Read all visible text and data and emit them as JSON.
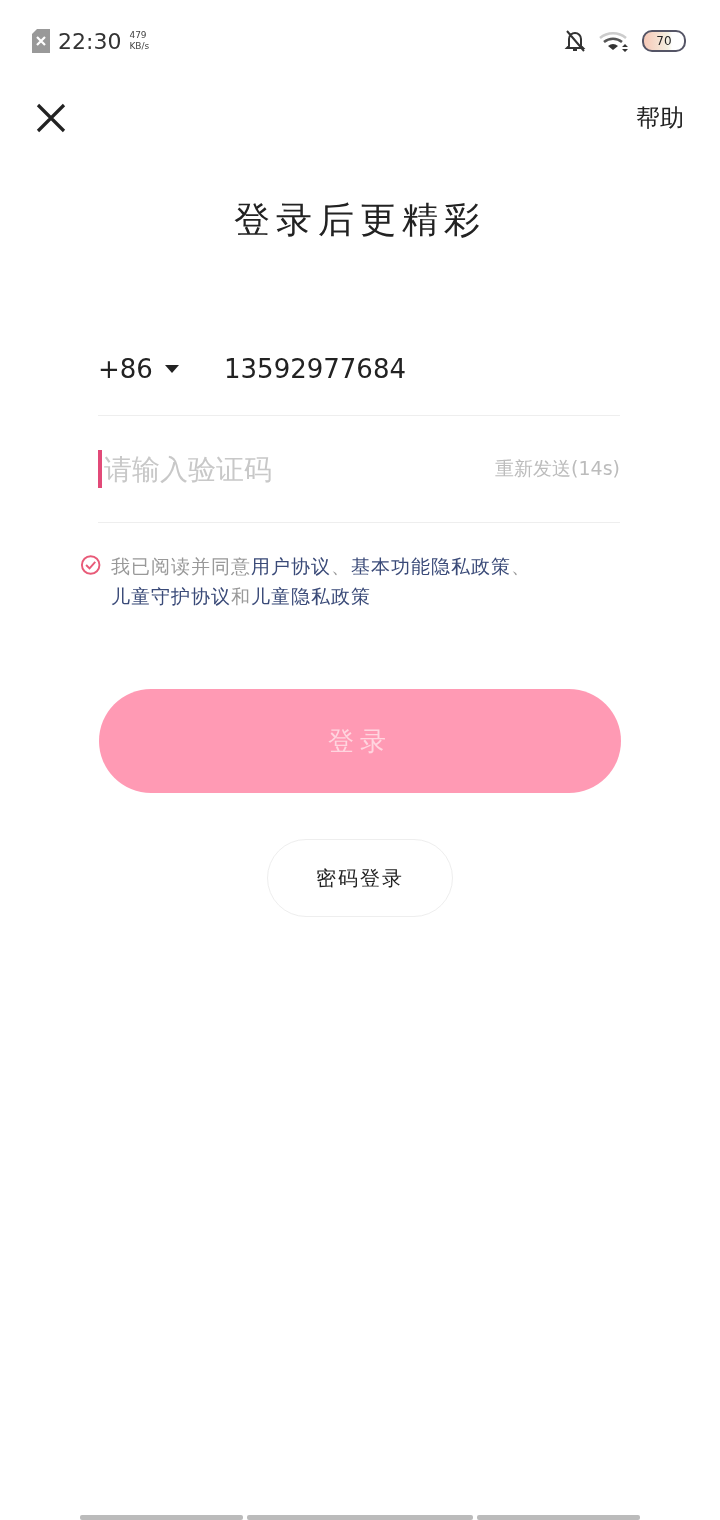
{
  "status_bar": {
    "time": "22:30",
    "speed_value": "479",
    "speed_unit": "KB/s",
    "battery": "70"
  },
  "header": {
    "help": "帮助"
  },
  "title": "登录后更精彩",
  "phone": {
    "country_code": "+86",
    "value": "13592977684"
  },
  "code": {
    "placeholder": "请输入验证码",
    "resend": "重新发送(14s)",
    "resend_disabled": true
  },
  "agreement": {
    "checked": true,
    "parts": [
      {
        "kind": "text",
        "text": "我已阅读并同意"
      },
      {
        "kind": "link",
        "text": "用户协议"
      },
      {
        "kind": "text",
        "text": "、"
      },
      {
        "kind": "link",
        "text": "基本功能隐私政策"
      },
      {
        "kind": "text",
        "text": "、"
      },
      {
        "kind": "link",
        "text": "儿童守护协议"
      },
      {
        "kind": "text",
        "text": "和"
      },
      {
        "kind": "link",
        "text": "儿童隐私政策"
      }
    ]
  },
  "login_button": {
    "label": "登录",
    "disabled": true
  },
  "password_login": "密码登录"
}
